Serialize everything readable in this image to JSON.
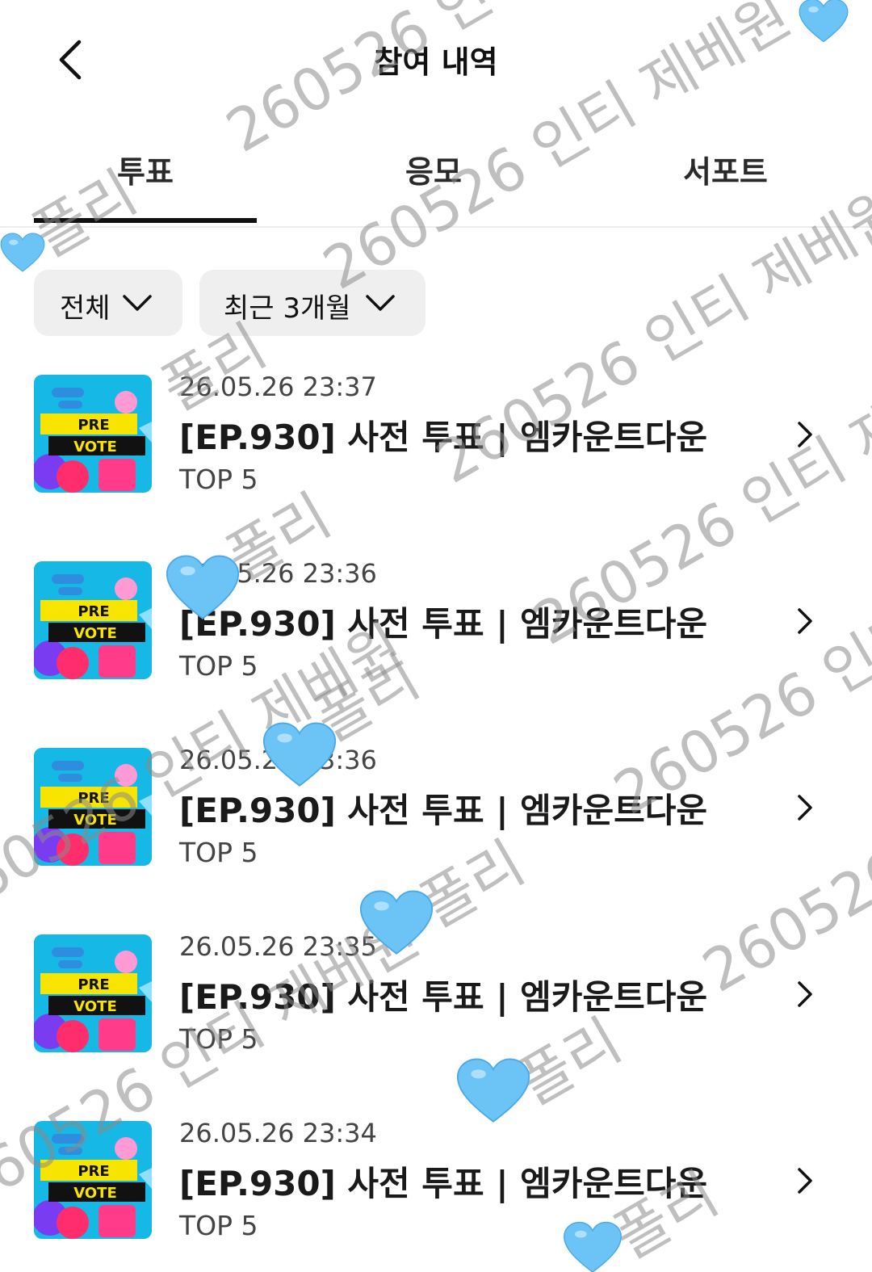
{
  "header": {
    "title": "참여 내역"
  },
  "tabs": [
    {
      "label": "투표",
      "active": true
    },
    {
      "label": "응모",
      "active": false
    },
    {
      "label": "서포트",
      "active": false
    }
  ],
  "filters": {
    "type": "전체",
    "period": "최근 3개월"
  },
  "items": [
    {
      "date": "26.05.26 23:37",
      "title": "[EP.930] 사전 투표 | 엠카운트다운",
      "rank": "TOP 5",
      "thumb_text": [
        "PRE",
        "VOTE"
      ]
    },
    {
      "date": "26.05.26 23:36",
      "title": "[EP.930] 사전 투표 | 엠카운트다운",
      "rank": "TOP 5",
      "thumb_text": [
        "PRE",
        "VOTE"
      ]
    },
    {
      "date": "26.05.26 23:36",
      "title": "[EP.930] 사전 투표 | 엠카운트다운",
      "rank": "TOP 5",
      "thumb_text": [
        "PRE",
        "VOTE"
      ]
    },
    {
      "date": "26.05.26 23:35",
      "title": "[EP.930] 사전 투표 | 엠카운트다운",
      "rank": "TOP 5",
      "thumb_text": [
        "PRE",
        "VOTE"
      ]
    },
    {
      "date": "26.05.26 23:34",
      "title": "[EP.930] 사전 투표 | 엠카운트다운",
      "rank": "TOP 5",
      "thumb_text": [
        "PRE",
        "VOTE"
      ]
    }
  ],
  "watermark": {
    "text_a": "260526 인티 제베원",
    "text_b": "폴리"
  },
  "colors": {
    "text": "#111111",
    "secondary": "#444444",
    "chip_bg": "#efefef",
    "tab_indicator": "#111111",
    "thumb_bg": "#16b8e6",
    "thumb_band_yellow": "#f7e400",
    "thumb_band_black": "#111111",
    "watermark": "#8a8a8a",
    "heart": "#6cc3f6"
  },
  "icons": {
    "back": "chevron-left-icon",
    "dropdown": "chevron-down-icon",
    "row_more": "chevron-right-icon",
    "heart": "blue-heart-sticker"
  }
}
